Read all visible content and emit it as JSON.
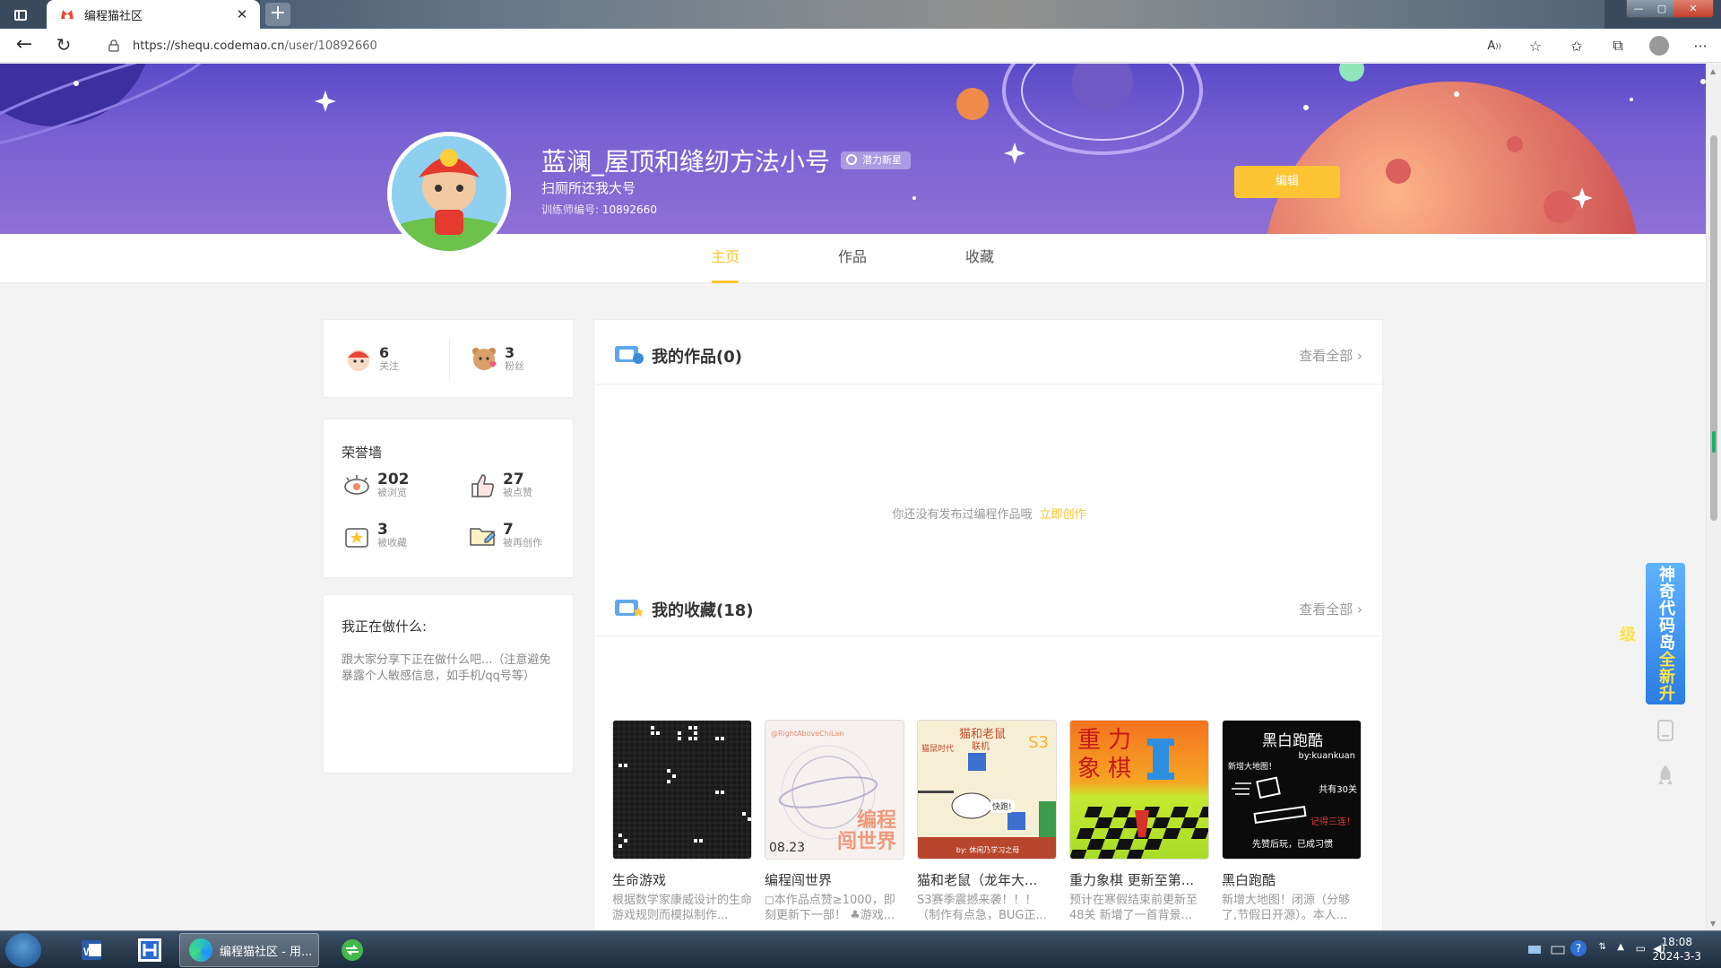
{
  "browser": {
    "tab_title": "编程猫社区",
    "url_host": "https://shequ.codemao.cn",
    "url_path": "/user/10892660"
  },
  "profile": {
    "username": "蓝澜_屋顶和缝纫方法小号",
    "badge": "潜力新星",
    "signature": "扫厕所还我大号",
    "trainer_label": "训练师编号:",
    "trainer_id": "10892660",
    "edit_label": "编辑"
  },
  "nav": {
    "tabs": [
      "主页",
      "作品",
      "收藏"
    ],
    "active": "主页"
  },
  "stats": {
    "following": {
      "num": "6",
      "label": "关注"
    },
    "fans": {
      "num": "3",
      "label": "粉丝"
    }
  },
  "honor": {
    "title": "荣誉墙",
    "views": {
      "num": "202",
      "label": "被浏览"
    },
    "likes": {
      "num": "27",
      "label": "被点赞"
    },
    "collected": {
      "num": "3",
      "label": "被收藏"
    },
    "remixed": {
      "num": "7",
      "label": "被再创作"
    }
  },
  "doing": {
    "title": "我正在做什么:",
    "text": "跟大家分享下正在做什么吧...（注意避免暴露个人敏感信息，如手机/qq号等）"
  },
  "my_works": {
    "title": "我的作品(0)",
    "view_all": "查看全部",
    "empty_text": "你还没有发布过编程作品哦",
    "create_link": "立即创作"
  },
  "my_collections": {
    "title": "我的收藏(18)",
    "view_all": "查看全部",
    "items": [
      {
        "name": "生命游戏",
        "desc": "根据数学家康威设计的生命游戏规则而模拟制作..."
      },
      {
        "name": "编程闯世界",
        "desc": "◻本作品点赞≥1000，即刻更新下一部！ ♣游戏..."
      },
      {
        "name": "猫和老鼠（龙年大...",
        "desc": "S3赛季震撼来袭！！！（制作有点急，BUG正..."
      },
      {
        "name": "重力象棋 更新至第...",
        "desc": "预计在寒假结束前更新至48关 新增了一首背景..."
      },
      {
        "name": "黑白跑酷",
        "desc": "新增大地图！闭源（分够了,节假日开源）。本人..."
      }
    ],
    "thumb_text": {
      "t2_top": "@RightAboveChiLan",
      "t2_title": "编程\n闯世界",
      "t2_date": "08.23",
      "t3_title": "猫和老鼠",
      "t3_sub": "联机",
      "t3_s3": "S3",
      "t3_left": "猫鼠时代",
      "t3_bubble": "快跑!",
      "t3_by": "by: 休闲乃学习之母",
      "t4_title": "重力\n象棋",
      "t5_title": "黑白跑酷",
      "t5_by": "by:kuankuan",
      "t5_a": "新增大地图！",
      "t5_b": "共有30关",
      "t5_c": "记得三连！",
      "t5_d": "先赞后玩，已成习惯"
    }
  },
  "side_promo": {
    "line1": "神奇代码岛",
    "line2": "全新升级"
  },
  "taskbar": {
    "edge_label": "编程猫社区 - 用...",
    "time": "18:08",
    "date": "2024-3-3"
  },
  "colors": {
    "accent": "#fec433",
    "banner": "#6a55cf"
  }
}
